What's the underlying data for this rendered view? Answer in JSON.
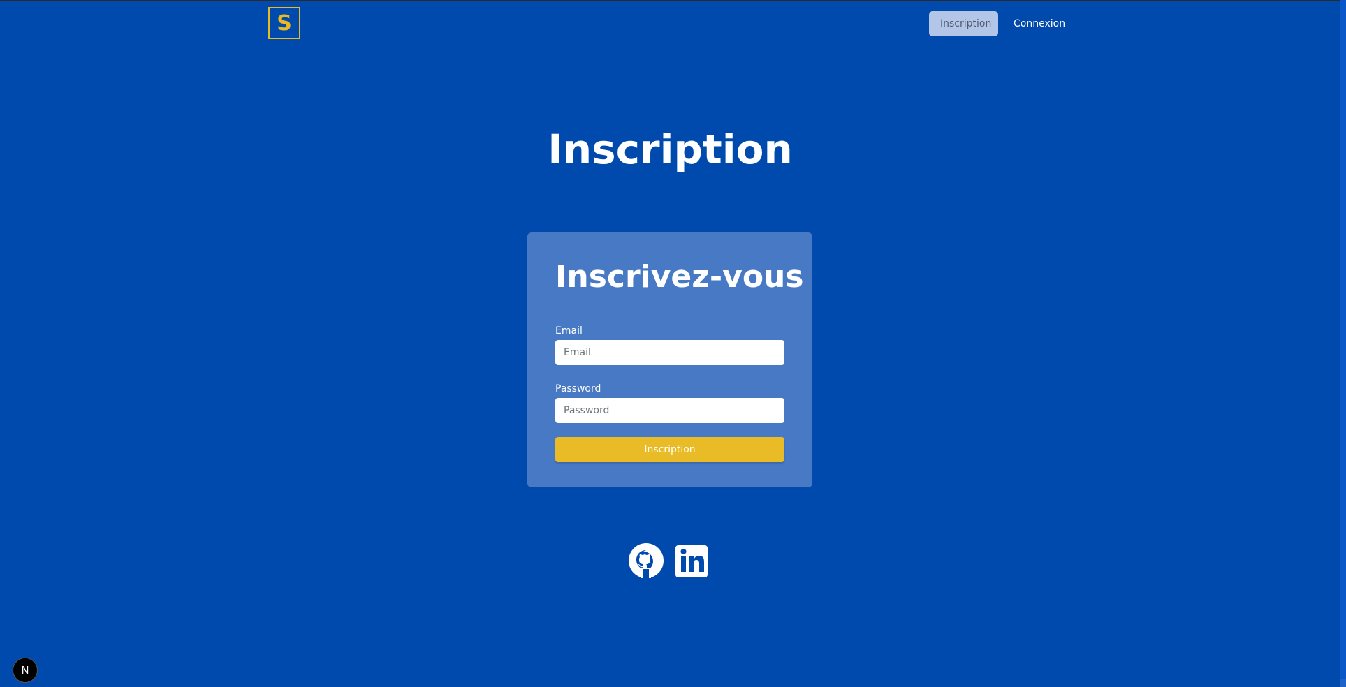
{
  "navbar": {
    "logo_letter": "S",
    "links": [
      {
        "label": "Inscription",
        "active": true
      },
      {
        "label": "Connexion",
        "active": false
      }
    ]
  },
  "hero": {
    "title": "Inscription"
  },
  "form": {
    "title": "Inscrivez-vous",
    "email_label": "Email",
    "email_placeholder": "Email",
    "password_label": "Password",
    "password_placeholder": "Password",
    "submit_label": "Inscription"
  },
  "socials": [
    {
      "icon": "github-icon"
    },
    {
      "icon": "linkedin-icon"
    }
  ],
  "dev_badge": {
    "letter": "N"
  },
  "colors": {
    "background": "#004aad",
    "card": "#4879c4",
    "accent": "#e9bb27",
    "active_nav": "#b4c6e7"
  }
}
